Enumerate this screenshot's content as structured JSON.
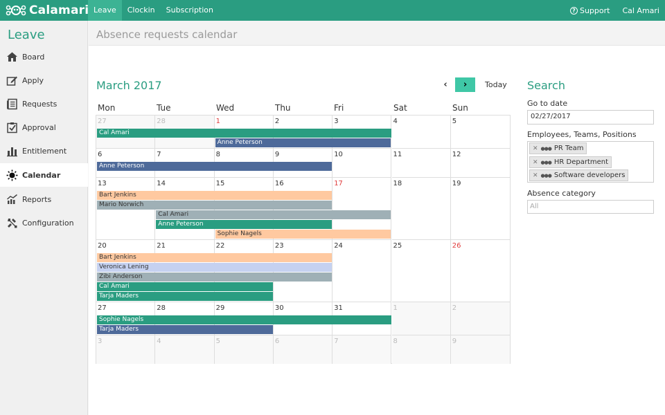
{
  "brand": "Calamari",
  "topnav": [
    "Leave",
    "Clockin",
    "Subscription"
  ],
  "topright": {
    "support": "Support",
    "user": "Cal Amari"
  },
  "sidebar": {
    "title": "Leave",
    "items": [
      {
        "label": "Board",
        "icon": "house-icon"
      },
      {
        "label": "Apply",
        "icon": "edit-icon"
      },
      {
        "label": "Requests",
        "icon": "list-icon"
      },
      {
        "label": "Approval",
        "icon": "checkbox-icon"
      },
      {
        "label": "Entitlement",
        "icon": "bar-chart-icon"
      },
      {
        "label": "Calendar",
        "icon": "sun-icon"
      },
      {
        "label": "Reports",
        "icon": "report-icon"
      },
      {
        "label": "Configuration",
        "icon": "tools-icon"
      }
    ],
    "active": "Calendar"
  },
  "page_title": "Absence requests calendar",
  "calendar": {
    "month": "March 2017",
    "today_label": "Today",
    "weekdays": [
      "Mon",
      "Tue",
      "Wed",
      "Thu",
      "Fri",
      "Sat",
      "Sun"
    ],
    "weeks": [
      [
        [
          "27",
          "other"
        ],
        [
          "28",
          "other"
        ],
        [
          "1",
          "holiday"
        ],
        [
          "2",
          ""
        ],
        [
          "3",
          ""
        ],
        [
          "4",
          ""
        ],
        [
          "5",
          ""
        ]
      ],
      [
        [
          "6",
          ""
        ],
        [
          "7",
          ""
        ],
        [
          "8",
          ""
        ],
        [
          "9",
          ""
        ],
        [
          "10",
          ""
        ],
        [
          "11",
          ""
        ],
        [
          "12",
          ""
        ]
      ],
      [
        [
          "13",
          ""
        ],
        [
          "14",
          ""
        ],
        [
          "15",
          ""
        ],
        [
          "16",
          ""
        ],
        [
          "17",
          "holiday"
        ],
        [
          "18",
          ""
        ],
        [
          "19",
          ""
        ]
      ],
      [
        [
          "20",
          ""
        ],
        [
          "21",
          ""
        ],
        [
          "22",
          ""
        ],
        [
          "23",
          ""
        ],
        [
          "24",
          ""
        ],
        [
          "25",
          ""
        ],
        [
          "26",
          "holiday"
        ]
      ],
      [
        [
          "27",
          ""
        ],
        [
          "28",
          ""
        ],
        [
          "29",
          ""
        ],
        [
          "30",
          ""
        ],
        [
          "31",
          ""
        ],
        [
          "1",
          "other"
        ],
        [
          "2",
          "other"
        ]
      ],
      [
        [
          "3",
          "other"
        ],
        [
          "4",
          "other"
        ],
        [
          "5",
          "other"
        ],
        [
          "6",
          "other"
        ],
        [
          "7",
          "other"
        ],
        [
          "8",
          "other"
        ],
        [
          "9",
          "other"
        ]
      ]
    ],
    "events": [
      {
        "name": "Cal Amari",
        "week": 0,
        "start": 0,
        "end": 4,
        "lane": 0,
        "color": "#2a9d81",
        "text": "#fff"
      },
      {
        "name": "Anne Peterson",
        "week": 0,
        "start": 2,
        "end": 4,
        "lane": 1,
        "color": "#4e6a9a",
        "text": "#fff"
      },
      {
        "name": "Anne Peterson",
        "week": 1,
        "start": 0,
        "end": 3,
        "lane": 0,
        "color": "#4e6a9a",
        "text": "#fff"
      },
      {
        "name": "Bart Jenkins",
        "week": 2,
        "start": 0,
        "end": 3,
        "lane": 0,
        "color": "#ffc9a0",
        "text": "#333"
      },
      {
        "name": "Mario Norwich",
        "week": 2,
        "start": 0,
        "end": 3,
        "lane": 1,
        "color": "#9fb0b6",
        "text": "#333"
      },
      {
        "name": "Cal Amari",
        "week": 2,
        "start": 1,
        "end": 4,
        "lane": 2,
        "color": "#9fb0b6",
        "text": "#333"
      },
      {
        "name": "Anne Peterson",
        "week": 2,
        "start": 1,
        "end": 3,
        "lane": 3,
        "color": "#2a9d81",
        "text": "#fff"
      },
      {
        "name": "Sophie Nagels",
        "week": 2,
        "start": 2,
        "end": 4,
        "lane": 4,
        "color": "#ffc9a0",
        "text": "#333"
      },
      {
        "name": "Bart Jenkins",
        "week": 3,
        "start": 0,
        "end": 3,
        "lane": 0,
        "color": "#ffc9a0",
        "text": "#333"
      },
      {
        "name": "Veronica Lening",
        "week": 3,
        "start": 0,
        "end": 3,
        "lane": 1,
        "color": "#c5d1f0",
        "text": "#333"
      },
      {
        "name": "Zibi Anderson",
        "week": 3,
        "start": 0,
        "end": 3,
        "lane": 2,
        "color": "#9fb0b6",
        "text": "#333"
      },
      {
        "name": "Cal Amari",
        "week": 3,
        "start": 0,
        "end": 2,
        "lane": 3,
        "color": "#2a9d81",
        "text": "#fff"
      },
      {
        "name": "Tarja Maders",
        "week": 3,
        "start": 0,
        "end": 2,
        "lane": 4,
        "color": "#2a9d81",
        "text": "#fff"
      },
      {
        "name": "Sophie Nagels",
        "week": 4,
        "start": 0,
        "end": 4,
        "lane": 0,
        "color": "#2a9d81",
        "text": "#fff"
      },
      {
        "name": "Tarja Maders",
        "week": 4,
        "start": 0,
        "end": 2,
        "lane": 1,
        "color": "#4e6a9a",
        "text": "#fff"
      }
    ]
  },
  "search": {
    "title": "Search",
    "go_to_date_label": "Go to date",
    "go_to_date_value": "02/27/2017",
    "employees_label": "Employees, Teams, Positions",
    "tags": [
      "PR Team",
      "HR Department",
      "Software developers"
    ],
    "absence_category_label": "Absence category",
    "absence_category_placeholder": "All"
  },
  "colors": {
    "brand": "#2a9d81",
    "nav_active": "#3cb394",
    "next_button": "#3fc7a6"
  }
}
